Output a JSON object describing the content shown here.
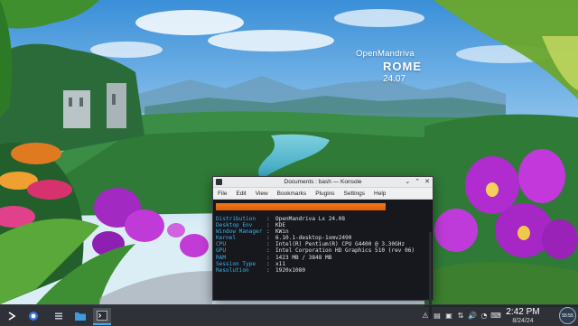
{
  "brand": {
    "line1": "OpenMandriva",
    "line2": "ROME",
    "line3": "24.07"
  },
  "konsole": {
    "title": "Documents : bash — Konsole",
    "menu": [
      "File",
      "Edit",
      "View",
      "Bookmarks",
      "Plugins",
      "Settings",
      "Help"
    ],
    "logo_color": "#f07a19",
    "info": [
      {
        "key": "Distribution",
        "sep": ":",
        "value": "OpenMandriva Lx 24.08"
      },
      {
        "key": "Desktop Env",
        "sep": ":",
        "value": "KDE"
      },
      {
        "key": "Window Manager",
        "sep": ":",
        "value": "KWin"
      },
      {
        "key": "Kernel",
        "sep": ":",
        "value": "6.10.1-desktop-1omv2490"
      },
      {
        "key": "CPU",
        "sep": ":",
        "value": "Intel(R) Pentium(R) CPU G4400 @ 3.30GHz"
      },
      {
        "key": "GPU",
        "sep": ":",
        "value": "Intel Corporation HD Graphics 510 (rev 06)"
      },
      {
        "key": "RAM",
        "sep": ":",
        "value": "1423 MB / 3848 MB"
      },
      {
        "key": "Session Type",
        "sep": ":",
        "value": "x11"
      },
      {
        "key": "Resolution",
        "sep": ":",
        "value": "1920x1080"
      }
    ]
  },
  "taskbar": {
    "clock_time": "2:42 PM",
    "clock_date": "8/24/24",
    "tray_icons": [
      "warning-icon",
      "clipboard-icon",
      "device-icon",
      "network-icon",
      "volume-icon",
      "wifi-icon",
      "keyboard-icon",
      "chevron-up-icon"
    ],
    "avatar_text": "55:55"
  },
  "colors": {
    "accent": "#f07a19",
    "taskbar": "#1f2227",
    "key_blue": "#3bb4e9"
  }
}
